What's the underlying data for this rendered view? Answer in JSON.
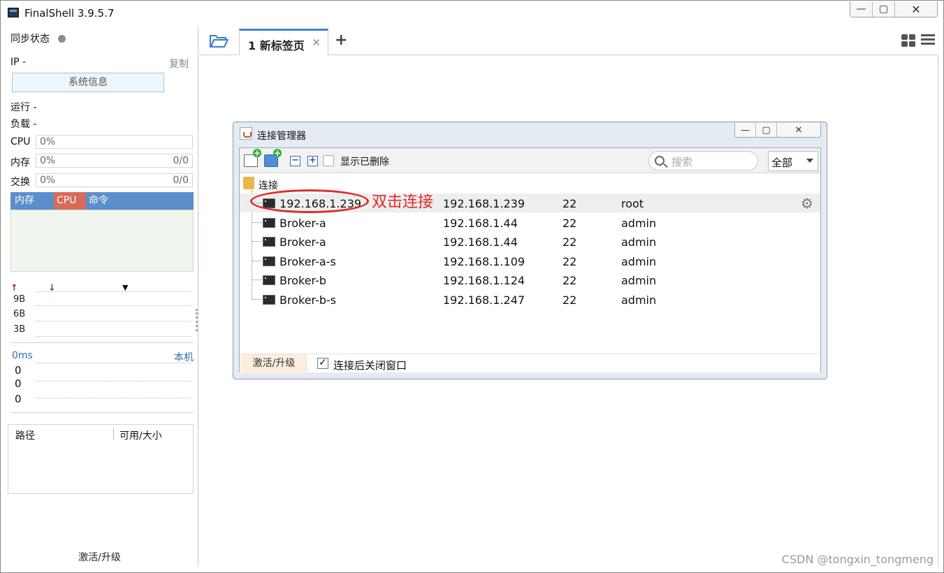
{
  "window": {
    "title": "FinalShell 3.9.5.7",
    "min": "—",
    "max": "▢",
    "close": "✕"
  },
  "left": {
    "sync_label": "同步状态",
    "ip_label": "IP  -",
    "copy_label": "复制",
    "sysinfo_button": "系统信息",
    "run_label": "运行 -",
    "load_label": "负载 -",
    "cpu_label": "CPU",
    "cpu_value": "0%",
    "mem_label": "内存",
    "mem_value": "0%",
    "mem_ratio": "0/0",
    "swap_label": "交换",
    "swap_value": "0%",
    "swap_ratio": "0/0",
    "proc_tabs": [
      "内存",
      "CPU",
      "命令"
    ],
    "net_y": [
      "9B",
      "6B",
      "3B"
    ],
    "ping_ms": "0ms",
    "ping_local": "本机",
    "ping_values": [
      "0",
      "0",
      "0"
    ],
    "disk_col_path": "路径",
    "disk_col_size": "可用/大小",
    "activate": "激活/升级"
  },
  "tabs": {
    "active_label": "1 新标签页",
    "close": "✕",
    "add": "+"
  },
  "dialog": {
    "title": "连接管理器",
    "show_deleted": "显示已删除",
    "search_placeholder": "搜索",
    "filter_value": "全部",
    "root": "连接",
    "rows": [
      {
        "name": "192.168.1.239",
        "host": "192.168.1.239",
        "port": "22",
        "user": "root"
      },
      {
        "name": "Broker-a",
        "host": "192.168.1.44",
        "port": "22",
        "user": "admin"
      },
      {
        "name": "Broker-a",
        "host": "192.168.1.44",
        "port": "22",
        "user": "admin"
      },
      {
        "name": "Broker-a-s",
        "host": "192.168.1.109",
        "port": "22",
        "user": "admin"
      },
      {
        "name": "Broker-b",
        "host": "192.168.1.124",
        "port": "22",
        "user": "admin"
      },
      {
        "name": "Broker-b-s",
        "host": "192.168.1.247",
        "port": "22",
        "user": "admin"
      }
    ],
    "annotation": "双击连接",
    "activate": "激活/升级",
    "close_after_connect": "连接后关闭窗口",
    "close_after_connect_checked": true
  },
  "watermark": "CSDN @tongxin_tongmeng",
  "colors": {
    "accent": "#3f7fd0",
    "annotation": "#e02b2b",
    "proc_tab_bg": "#5a8fcc",
    "cpu_tab": "#d76a58"
  }
}
